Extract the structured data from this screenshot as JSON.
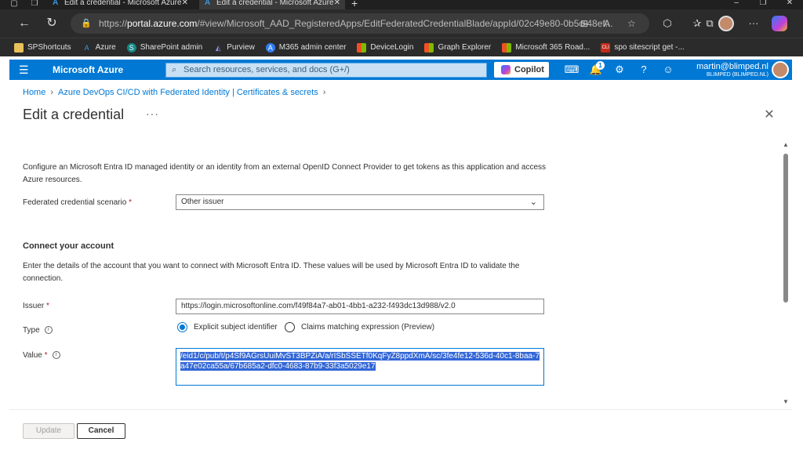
{
  "browser": {
    "tabs": [
      {
        "title": "Edit a credential - Microsoft Azure",
        "active": false
      },
      {
        "title": "Edit a credential - Microsoft Azure",
        "active": true
      }
    ],
    "address": {
      "prefix": "https://",
      "host": "portal.azure.com",
      "path": "/#view/Microsoft_AAD_RegisteredApps/EditFederatedCredentialBlade/appId/02c49e80-0b5c-48ef..."
    },
    "favorites": [
      {
        "label": "SPShortcuts",
        "icon": "folder-icon",
        "color": "#e8c15a"
      },
      {
        "label": "Azure",
        "icon": "azure-icon",
        "color": "#3a96dd"
      },
      {
        "label": "SharePoint admin",
        "icon": "sharepoint-icon",
        "color": "#138785"
      },
      {
        "label": "Purview",
        "icon": "purview-icon",
        "color": "#5b5fc7"
      },
      {
        "label": "M365 admin center",
        "icon": "m365-icon",
        "color": "#2f7cf6"
      },
      {
        "label": "DeviceLogin",
        "icon": "microsoft-icon",
        "color": "#f25022"
      },
      {
        "label": "Graph Explorer",
        "icon": "microsoft-icon",
        "color": "#f25022"
      },
      {
        "label": "Microsoft 365 Road...",
        "icon": "microsoft-icon",
        "color": "#f25022"
      },
      {
        "label": "spo sitescript get -...",
        "icon": "cli-icon",
        "color": "#c42b1c"
      }
    ]
  },
  "azure_header": {
    "brand": "Microsoft Azure",
    "search_placeholder": "Search resources, services, and docs (G+/)",
    "copilot_label": "Copilot",
    "notification_count": "1",
    "account_email": "martin@blimped.nl",
    "account_tenant": "BLIMPED (BLIMPED.NL)"
  },
  "breadcrumb": {
    "home": "Home",
    "app": "Azure DevOps CI/CD with Federated Identity | Certificates & secrets"
  },
  "page": {
    "title": "Edit a credential",
    "more": "···",
    "intro": "Configure an Microsoft Entra ID managed identity or an identity from an external OpenID Connect Provider to get tokens as this application and access Azure resources.",
    "scenario_label": "Federated credential scenario",
    "scenario_value": "Other issuer",
    "section_title": "Connect your account",
    "section_desc": "Enter the details of the account that you want to connect with Microsoft Entra ID. These values will be used by Microsoft Entra ID to validate the connection.",
    "issuer_label": "Issuer",
    "issuer_value": "https://login.microsoftonline.com/f49f84a7-ab01-4bb1-a232-f493dc13d988/v2.0",
    "type_label": "Type",
    "type_options": [
      {
        "label": "Explicit subject identifier",
        "selected": true
      },
      {
        "label": "Claims matching expression (Preview)",
        "selected": false
      }
    ],
    "value_label": "Value",
    "value_text": "/eid1/c/pub/t/p4Sf9AGrsUuiMvST3BPZiA/a/rISbSSETf0KqFyZ8ppdXmA/sc/3fe4fe12-536d-40c1-8baa-7a47e02ca55a/67b685a2-dfc0-4683-87b9-33f3a5029e17"
  },
  "footer": {
    "update_label": "Update",
    "cancel_label": "Cancel"
  },
  "colors": {
    "azure_blue": "#0078d4",
    "required": "#a4262c",
    "selection": "#3367d6"
  }
}
